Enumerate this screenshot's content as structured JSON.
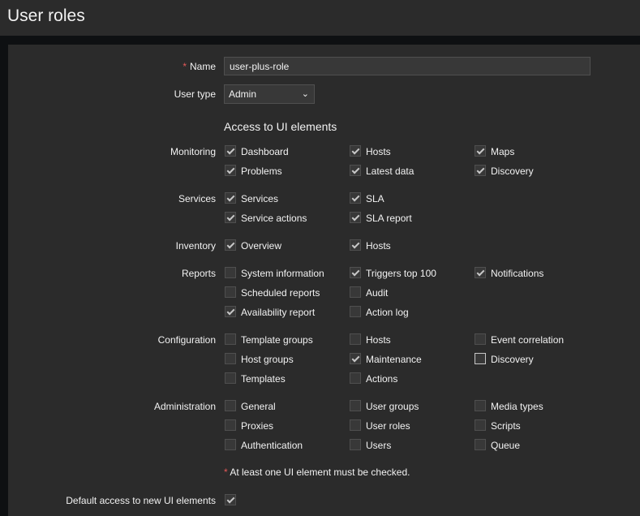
{
  "page": {
    "title": "User roles"
  },
  "form": {
    "name_label": "Name",
    "name_required": "*",
    "name_value": "user-plus-role",
    "user_type_label": "User type",
    "user_type_value": "Admin",
    "ui_section_title": "Access to UI elements",
    "note_star": "*",
    "note_text": " At least one UI element must be checked.",
    "default_access_label": "Default access to new UI elements",
    "default_access_checked": true
  },
  "groups": {
    "monitoring": {
      "label": "Monitoring",
      "items": [
        {
          "label": "Dashboard",
          "checked": true
        },
        {
          "label": "Hosts",
          "checked": true
        },
        {
          "label": "Maps",
          "checked": true
        },
        {
          "label": "Problems",
          "checked": true
        },
        {
          "label": "Latest data",
          "checked": true
        },
        {
          "label": "Discovery",
          "checked": true
        }
      ]
    },
    "services": {
      "label": "Services",
      "items": [
        {
          "label": "Services",
          "checked": true
        },
        {
          "label": "SLA",
          "checked": true
        },
        {
          "label": "Service actions",
          "checked": true
        },
        {
          "label": "SLA report",
          "checked": true
        }
      ]
    },
    "inventory": {
      "label": "Inventory",
      "items": [
        {
          "label": "Overview",
          "checked": true
        },
        {
          "label": "Hosts",
          "checked": true
        }
      ]
    },
    "reports": {
      "label": "Reports",
      "items": [
        {
          "label": "System information",
          "checked": false
        },
        {
          "label": "Triggers top 100",
          "checked": true
        },
        {
          "label": "Notifications",
          "checked": true
        },
        {
          "label": "Scheduled reports",
          "checked": false
        },
        {
          "label": "Audit",
          "checked": false
        },
        {
          "label": "Availability report",
          "checked": true
        },
        {
          "label": "Action log",
          "checked": false
        }
      ]
    },
    "configuration": {
      "label": "Configuration",
      "items": [
        {
          "label": "Template groups",
          "checked": false
        },
        {
          "label": "Hosts",
          "checked": false
        },
        {
          "label": "Event correlation",
          "checked": false
        },
        {
          "label": "Host groups",
          "checked": false
        },
        {
          "label": "Maintenance",
          "checked": true
        },
        {
          "label": "Discovery",
          "checked": false
        },
        {
          "label": "Templates",
          "checked": false
        },
        {
          "label": "Actions",
          "checked": false
        }
      ]
    },
    "administration": {
      "label": "Administration",
      "items": [
        {
          "label": "General",
          "checked": false
        },
        {
          "label": "User groups",
          "checked": false
        },
        {
          "label": "Media types",
          "checked": false
        },
        {
          "label": "Proxies",
          "checked": false
        },
        {
          "label": "User roles",
          "checked": false
        },
        {
          "label": "Scripts",
          "checked": false
        },
        {
          "label": "Authentication",
          "checked": false
        },
        {
          "label": "Users",
          "checked": false
        },
        {
          "label": "Queue",
          "checked": false
        }
      ]
    }
  }
}
